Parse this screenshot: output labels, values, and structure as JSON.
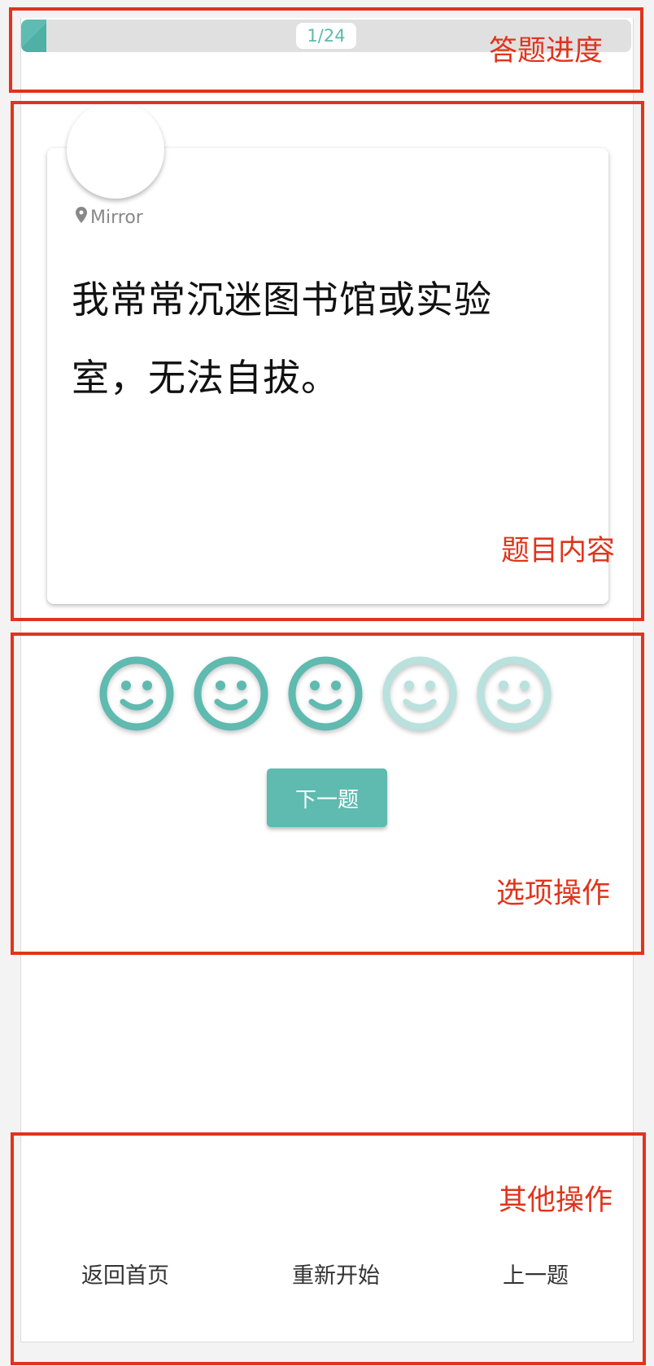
{
  "progress": {
    "label": "1/24",
    "fraction": 0.0417
  },
  "question": {
    "location": "Mirror",
    "text_line1": "我常常沉迷图书馆或实验",
    "text_line2": "室，无法自拔。"
  },
  "options": {
    "rating": 3,
    "max": 5,
    "active_color": "#5fbab0",
    "inactive_color": "#b9e1dd",
    "next_label": "下一题"
  },
  "footer": {
    "home_label": "返回首页",
    "restart_label": "重新开始",
    "prev_label": "上一题"
  },
  "annotations": {
    "progress": "答题进度",
    "question": "题目内容",
    "options": "选项操作",
    "other": "其他操作",
    "color": "#e0341c"
  }
}
